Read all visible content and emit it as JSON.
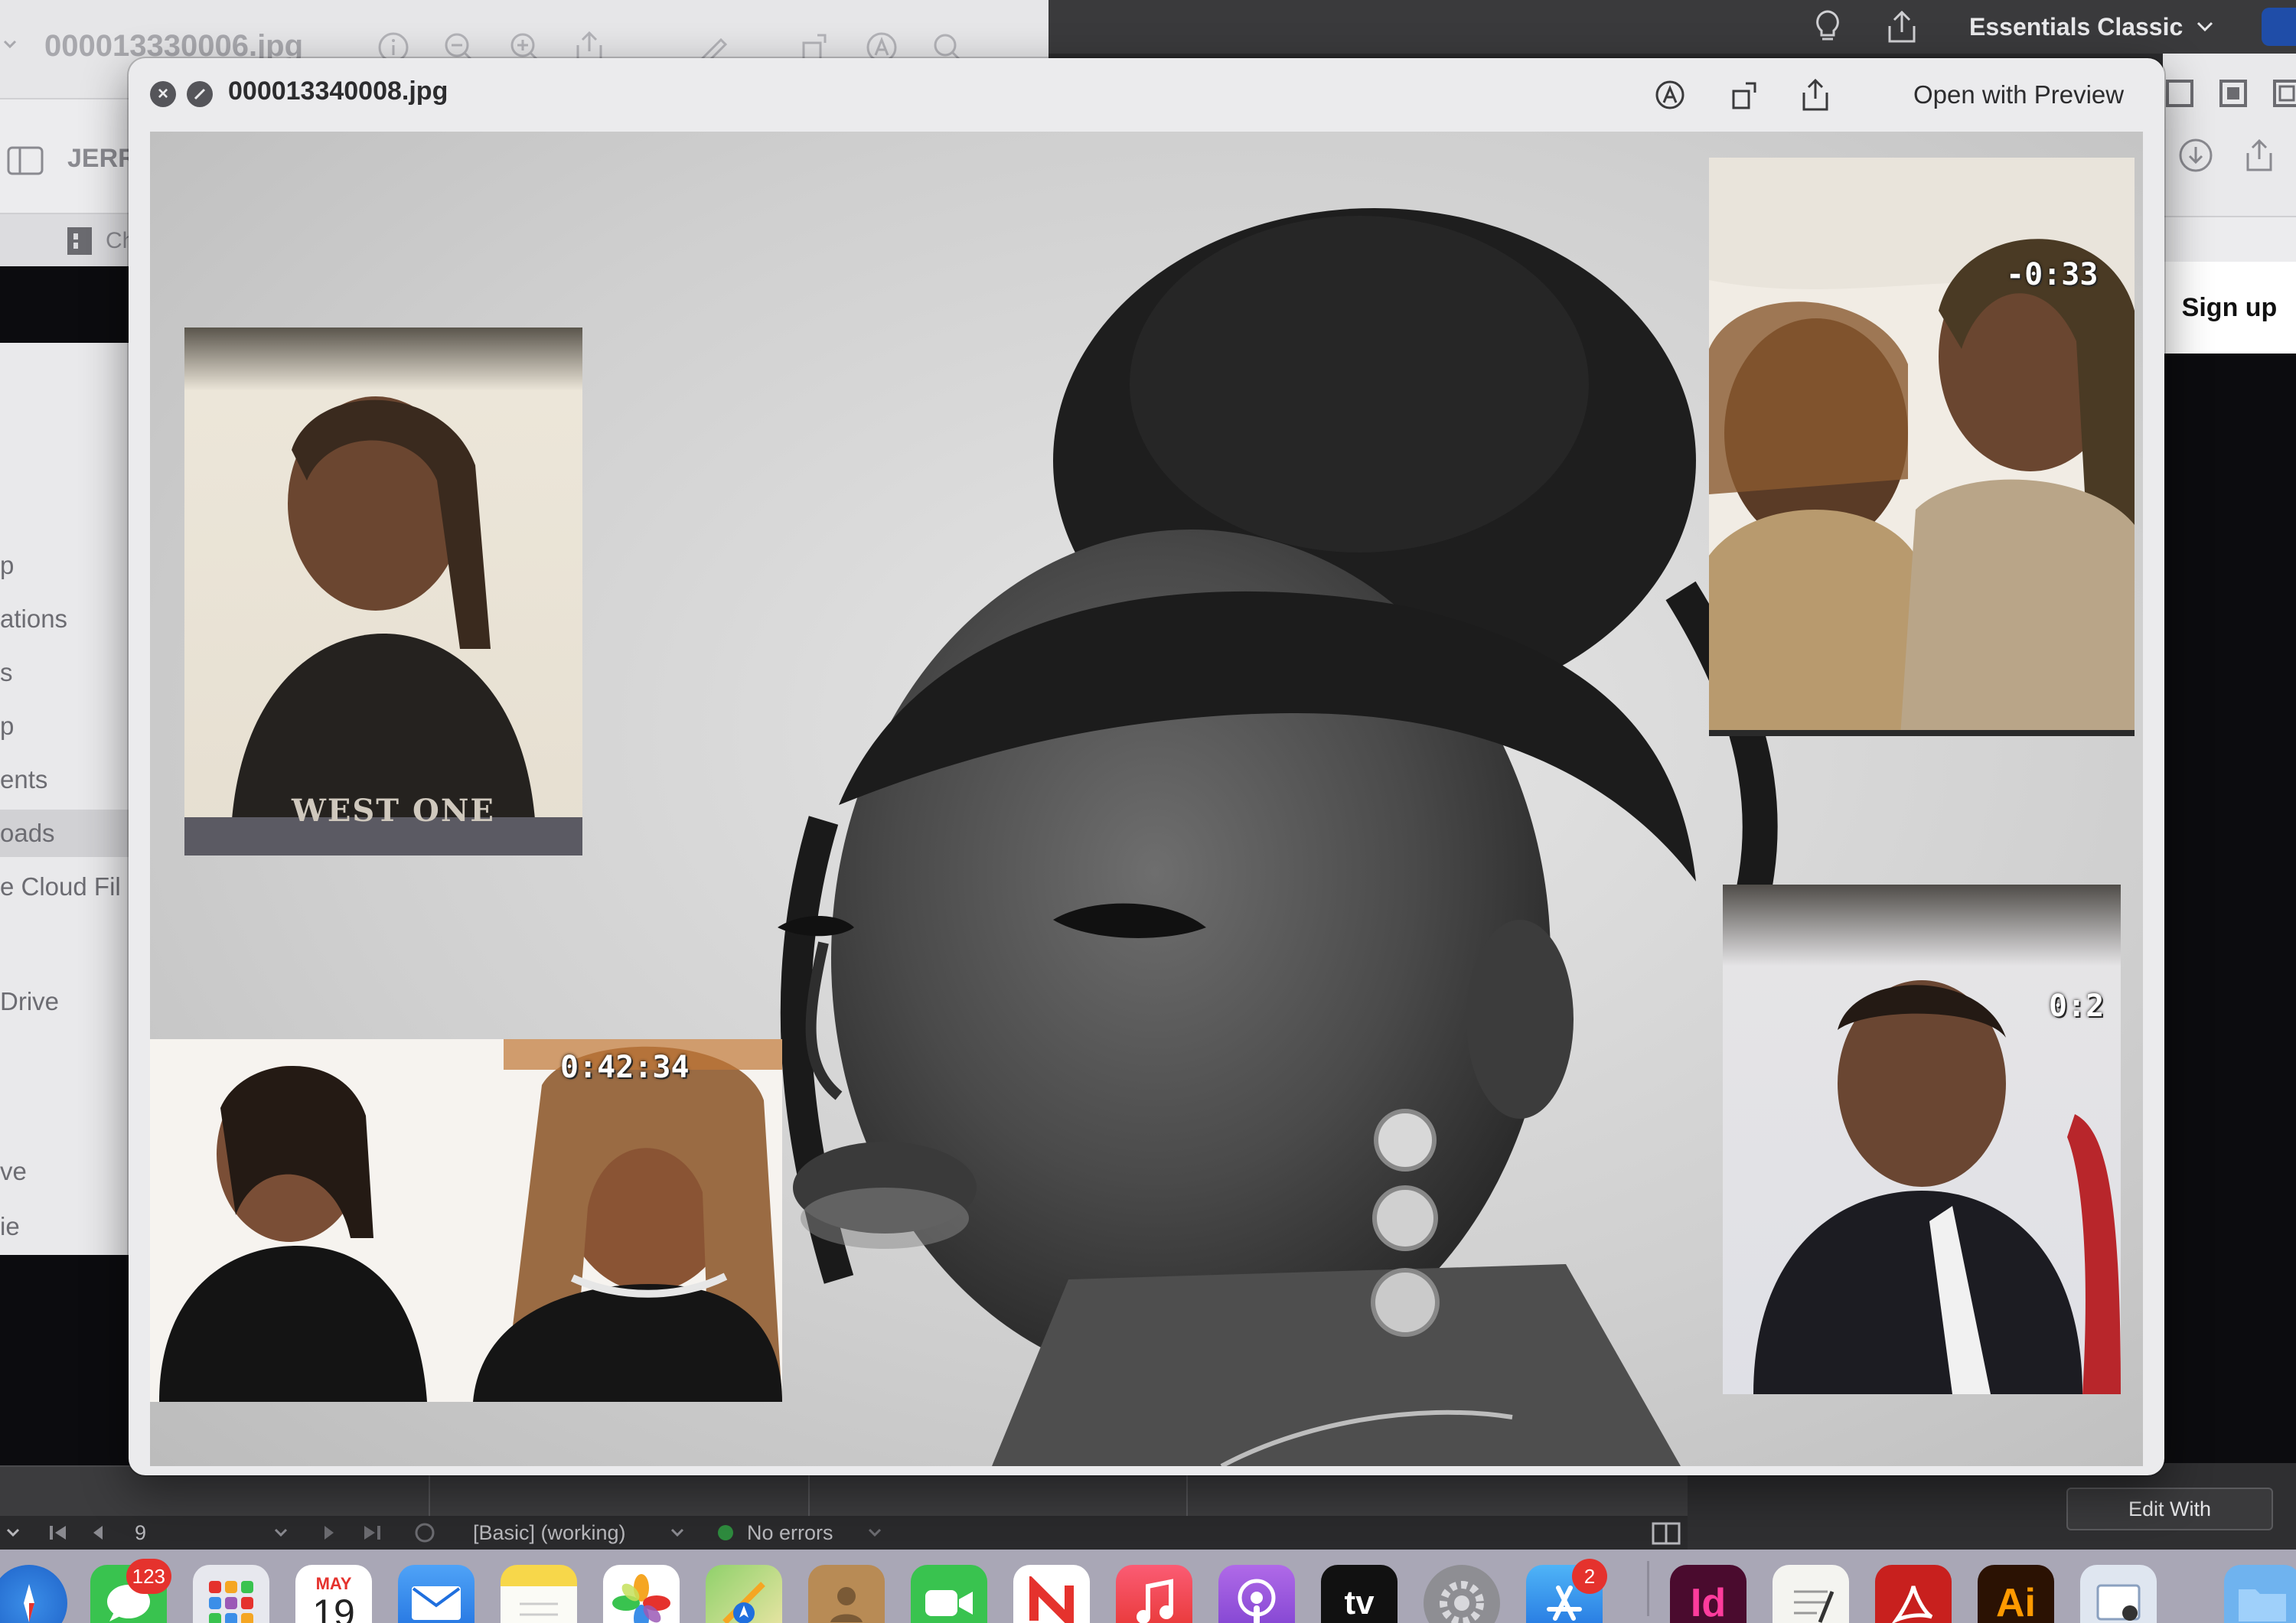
{
  "background_app": {
    "workspace_label": "Essentials Classic",
    "signup_label": "Sign up",
    "edit_with_label": "Edit With",
    "filmstrip": {
      "page_number": "9",
      "preset_status": "[Basic] (working)",
      "error_status": "No errors"
    }
  },
  "background_preview": {
    "filename": "000013330006.jpg",
    "toolbar_label": "JERR",
    "tab_label": "Ch",
    "sidebar_items": [
      "p",
      "ations",
      "s",
      "p",
      "ents",
      "oads",
      "e Cloud Fil",
      "Drive",
      "ve",
      "ie"
    ],
    "active_sidebar_index": 5
  },
  "quicklook": {
    "title": "000013340008.jpg",
    "open_with_label": "Open with Preview",
    "image": {
      "insets": [
        {
          "shirt_text": "WEST ONE"
        },
        {
          "timecode": "-0:33"
        },
        {
          "timecode": "0:42:34"
        },
        {
          "timecode": "0:2"
        }
      ]
    }
  },
  "dock": {
    "items": [
      {
        "name": "safari",
        "label": ""
      },
      {
        "name": "messages",
        "label": "",
        "badge": "123"
      },
      {
        "name": "launchpad",
        "label": ""
      },
      {
        "name": "calendar",
        "month": "MAY",
        "day": "19"
      },
      {
        "name": "mail",
        "label": ""
      },
      {
        "name": "notes",
        "label": ""
      },
      {
        "name": "photos",
        "label": ""
      },
      {
        "name": "maps",
        "label": ""
      },
      {
        "name": "contacts",
        "label": ""
      },
      {
        "name": "facetime",
        "label": ""
      },
      {
        "name": "news",
        "label": ""
      },
      {
        "name": "music",
        "label": ""
      },
      {
        "name": "podcasts",
        "label": ""
      },
      {
        "name": "tv",
        "label": "tv"
      },
      {
        "name": "system-settings",
        "label": ""
      },
      {
        "name": "app-store",
        "label": "",
        "badge": "2"
      },
      {
        "name": "indesign",
        "label": "Id"
      },
      {
        "name": "textedit",
        "label": ""
      },
      {
        "name": "acrobat",
        "label": ""
      },
      {
        "name": "illustrator",
        "label": "Ai"
      },
      {
        "name": "preview",
        "label": ""
      },
      {
        "name": "finder-folder",
        "label": ""
      }
    ]
  },
  "colors": {
    "indesign": "#4a0b2e",
    "illustrator": "#2b1203",
    "acrobat": "#c8201e",
    "accent": "#1f4da8"
  }
}
